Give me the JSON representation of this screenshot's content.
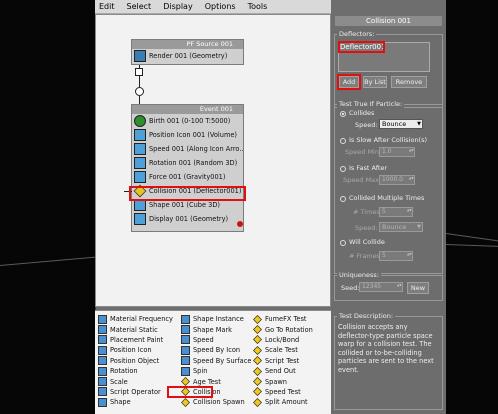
{
  "menu": [
    "Edit",
    "Select",
    "Display",
    "Options",
    "Tools"
  ],
  "pf_source": {
    "title": "PF Source 001",
    "rows": [
      {
        "label": "Render 001 (Geometry)",
        "icon": "render-icon"
      }
    ]
  },
  "event": {
    "title": "Event 001",
    "rows": [
      {
        "label": "Birth 001 (0-100 T:5000)",
        "icon": "birth-icon"
      },
      {
        "label": "Position Icon 001 (Volume)",
        "icon": "position-icon"
      },
      {
        "label": "Speed 001 (Along Icon Arro...",
        "icon": "speed-icon"
      },
      {
        "label": "Rotation 001 (Random 3D)",
        "icon": "rotation-icon"
      },
      {
        "label": "Force 001 (Gravity001)",
        "icon": "force-icon"
      },
      {
        "label": "Collision 001 (Deflector001)",
        "icon": "collision-test-icon"
      },
      {
        "label": "Shape 001 (Cube 3D)",
        "icon": "shape-icon"
      },
      {
        "label": "Display 001 (Geometry)",
        "icon": "display-icon"
      }
    ]
  },
  "panel": {
    "title": "Collision 001",
    "deflectors_label": "Deflectors:",
    "deflector_item": "Deflector001",
    "add": "Add",
    "by_list": "By List",
    "remove": "Remove",
    "test_label": "Test True If Particle:",
    "collides": "Collides",
    "speed_label": "Speed:",
    "speed_value": "Bounce",
    "slow_after": "Is Slow After Collision(s)",
    "speed_min": "Speed Min:",
    "speed_min_val": "1.0",
    "fast_after": "Is Fast After",
    "speed_max": "Speed Max:",
    "speed_max_val": "1000.0",
    "collided_multiple": "Collided Multiple Times",
    "times_label": "# Times:",
    "times_val": "5",
    "speed2_label": "Speed:",
    "speed2_value": "Bounce",
    "will_collide": "Will Collide",
    "frames_label": "# Frames:",
    "frames_val": "5",
    "uniqueness": "Uniqueness:",
    "seed_label": "Seed:",
    "seed_val": "12345",
    "new": "New"
  },
  "depot": {
    "col1": [
      "Material Frequency",
      "Material Static",
      "Placement Paint",
      "Position Icon",
      "Position Object",
      "Rotation",
      "Scale",
      "Script Operator",
      "Shape"
    ],
    "col2": [
      "Shape Instance",
      "Shape Mark",
      "Speed",
      "Speed By Icon",
      "Speed By Surface",
      "Spin",
      "Age Test",
      "Collision",
      "Collision Spawn"
    ],
    "col3": [
      "FumeFX Test",
      "Go To Rotation",
      "Lock/Bond",
      "Scale Test",
      "Script Test",
      "Send Out",
      "Spawn",
      "Speed Test",
      "Split Amount"
    ]
  },
  "description": {
    "title": "Test Description:",
    "text": "Collision accepts any deflector-type particle space warp for a collision test. The collided or to-be-colliding particles are sent to the next event."
  }
}
